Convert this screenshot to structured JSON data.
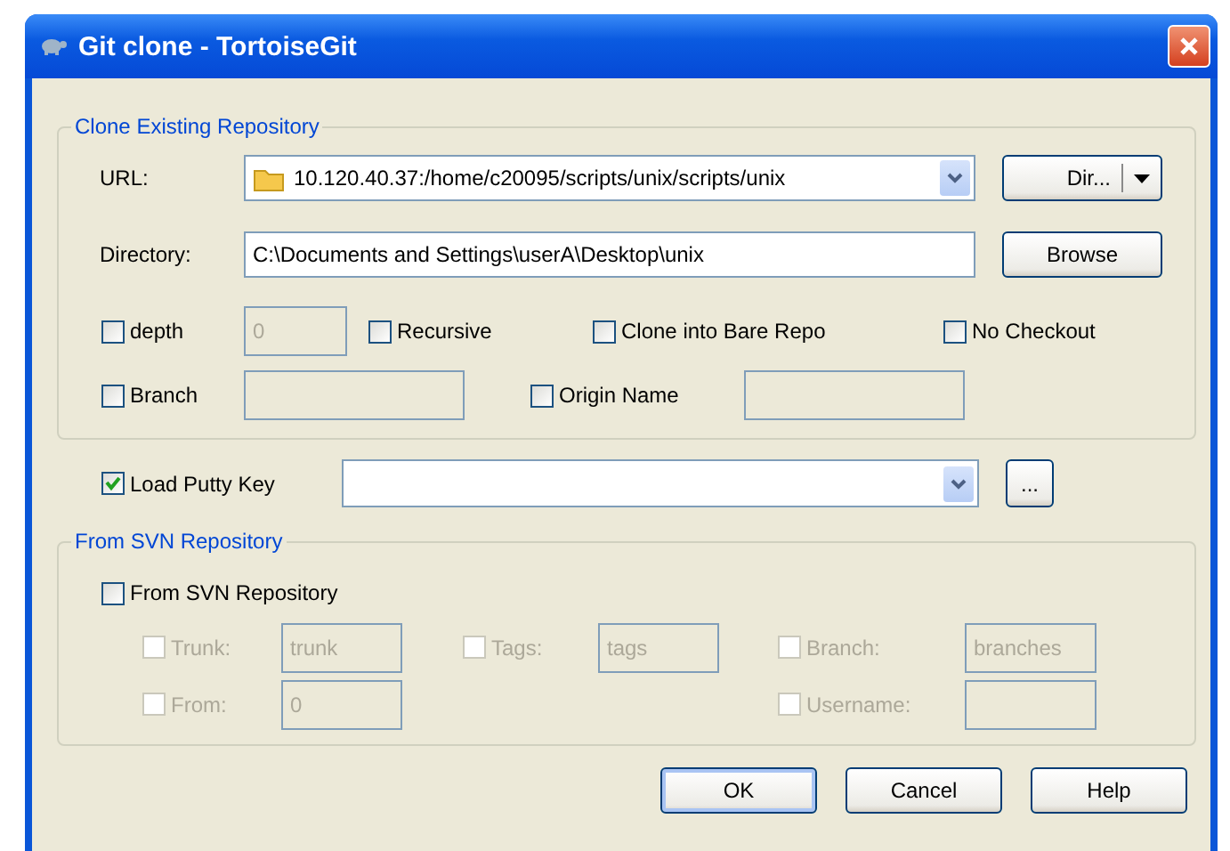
{
  "window": {
    "title": "Git clone - TortoiseGit"
  },
  "clone_group": {
    "title": "Clone Existing Repository",
    "url": {
      "label": "URL:",
      "value": "10.120.40.37:/home/c20095/scripts/unix/scripts/unix",
      "button": "Dir..."
    },
    "directory": {
      "label": "Directory:",
      "value": "C:\\Documents and Settings\\userA\\Desktop\\unix",
      "button": "Browse"
    },
    "option_rows": [
      [
        {
          "kind": "check",
          "label": "depth",
          "checked": false
        },
        {
          "kind": "field",
          "value": "0",
          "disabled": true
        },
        {
          "kind": "check",
          "label": "Recursive",
          "checked": false
        },
        {
          "kind": "check",
          "label": "Clone into Bare Repo",
          "checked": false
        },
        {
          "kind": "check",
          "label": "No Checkout",
          "checked": false
        }
      ],
      [
        {
          "kind": "check",
          "label": "Branch",
          "checked": false
        },
        {
          "kind": "field",
          "disabled": true
        },
        {
          "kind": "check",
          "label": "Origin Name",
          "checked": false
        },
        {
          "kind": "field",
          "disabled": true
        }
      ]
    ]
  },
  "putty": {
    "label": "Load Putty Key",
    "checked": true,
    "button": "..."
  },
  "svn_group": {
    "title": "From SVN Repository",
    "enable": {
      "label": "From SVN Repository",
      "checked": false
    },
    "columns": [
      [
        {
          "label": "Trunk:",
          "checked": false,
          "disabled": true,
          "value": "trunk"
        },
        {
          "label": "From:",
          "checked": false,
          "disabled": true,
          "value": "0"
        }
      ],
      [
        {
          "label": "Tags:",
          "checked": false,
          "disabled": true,
          "value": "tags"
        }
      ],
      [
        {
          "label": "Branch:",
          "checked": false,
          "disabled": true,
          "value": "branches"
        },
        {
          "label": "Username:",
          "checked": false,
          "disabled": true
        }
      ]
    ]
  },
  "buttons": [
    {
      "label": "OK",
      "default": true
    },
    {
      "label": "Cancel",
      "default": false
    },
    {
      "label": "Help",
      "default": false
    }
  ]
}
